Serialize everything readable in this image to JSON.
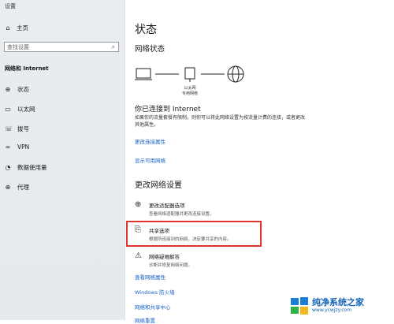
{
  "window": {
    "title": "设置"
  },
  "sidebar": {
    "home_label": "主页",
    "search_placeholder": "查找设置",
    "section_label": "网络和 Internet",
    "items": [
      {
        "label": "状态",
        "icon": "status-icon"
      },
      {
        "label": "以太网",
        "icon": "ethernet-icon"
      },
      {
        "label": "拨号",
        "icon": "dialup-icon"
      },
      {
        "label": "VPN",
        "icon": "vpn-icon"
      },
      {
        "label": "数据使用量",
        "icon": "data-usage-icon"
      },
      {
        "label": "代理",
        "icon": "proxy-icon"
      }
    ]
  },
  "main": {
    "title": "状态",
    "network_status_label": "网络状态",
    "diagram": {
      "adapter_label": "以太网",
      "adapter_sublabel": "专用网络"
    },
    "connection_heading": "你已连接到 Internet",
    "connection_desc": "如果你的流量套餐有限制，则你可以将此网络设置为按流量计费的连接，或者更改其他属性。",
    "links": {
      "change_properties": "更改连接属性",
      "show_networks": "显示可用网络"
    },
    "change_settings_heading": "更改网络设置",
    "options": [
      {
        "title": "更改适配器选项",
        "sub": "查看网络适配器并更改连接设置。",
        "icon": "adapter-icon"
      },
      {
        "title": "共享选项",
        "sub": "根据所连接到的网络，决定要共享的内容。",
        "icon": "sharing-icon"
      },
      {
        "title": "网络疑难解答",
        "sub": "诊断并修复网络问题。",
        "icon": "warning-icon"
      }
    ],
    "bottom_links": [
      "查看网络属性",
      "Windows 防火墙",
      "网络和共享中心",
      "网络重置"
    ]
  },
  "watermark": {
    "text": "纯净系统之家",
    "url": "www.ycwjzy.com"
  },
  "colors": {
    "link": "#1a64c8",
    "highlight": "#e0342c",
    "sidebar_bg": "#e7ebee"
  }
}
